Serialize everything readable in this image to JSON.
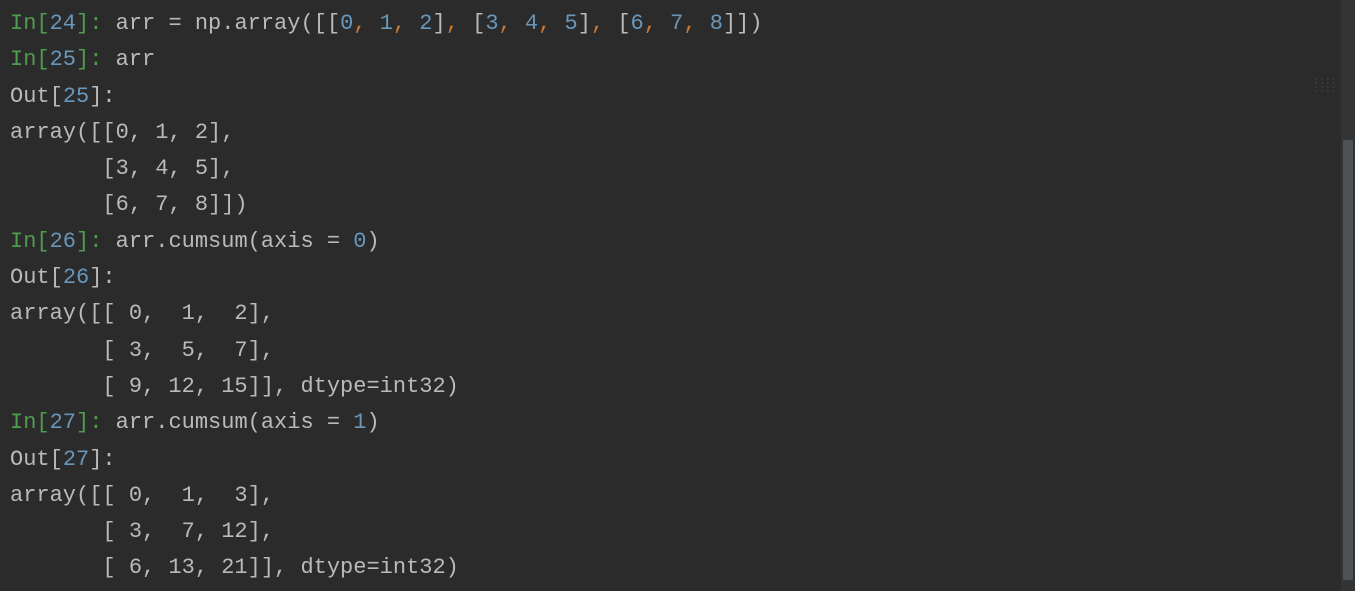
{
  "lines": [
    {
      "type": "in",
      "n": "24",
      "code_tokens": [
        {
          "t": " ",
          "c": "paren"
        },
        {
          "t": "arr ",
          "c": "func-name"
        },
        {
          "t": "=",
          "c": "op"
        },
        {
          "t": " np",
          "c": "func-name"
        },
        {
          "t": ".",
          "c": "dot"
        },
        {
          "t": "array([[",
          "c": "paren"
        },
        {
          "t": "0",
          "c": "number"
        },
        {
          "t": ", ",
          "c": "keyword"
        },
        {
          "t": "1",
          "c": "number"
        },
        {
          "t": ", ",
          "c": "keyword"
        },
        {
          "t": "2",
          "c": "number"
        },
        {
          "t": "]",
          "c": "paren"
        },
        {
          "t": ", ",
          "c": "keyword"
        },
        {
          "t": "[",
          "c": "paren"
        },
        {
          "t": "3",
          "c": "number"
        },
        {
          "t": ", ",
          "c": "keyword"
        },
        {
          "t": "4",
          "c": "number"
        },
        {
          "t": ", ",
          "c": "keyword"
        },
        {
          "t": "5",
          "c": "number"
        },
        {
          "t": "]",
          "c": "paren"
        },
        {
          "t": ", ",
          "c": "keyword"
        },
        {
          "t": "[",
          "c": "paren"
        },
        {
          "t": "6",
          "c": "number"
        },
        {
          "t": ", ",
          "c": "keyword"
        },
        {
          "t": "7",
          "c": "number"
        },
        {
          "t": ", ",
          "c": "keyword"
        },
        {
          "t": "8",
          "c": "number"
        },
        {
          "t": "]])",
          "c": "paren"
        }
      ]
    },
    {
      "type": "in",
      "n": "25",
      "code_tokens": [
        {
          "t": " arr",
          "c": "func-name"
        }
      ]
    },
    {
      "type": "out",
      "n": "25",
      "text": ""
    },
    {
      "type": "plain",
      "text": "array([[0, 1, 2],"
    },
    {
      "type": "plain",
      "text": "       [3, 4, 5],"
    },
    {
      "type": "plain",
      "text": "       [6, 7, 8]])"
    },
    {
      "type": "in",
      "n": "26",
      "code_tokens": [
        {
          "t": " arr",
          "c": "func-name"
        },
        {
          "t": ".",
          "c": "dot"
        },
        {
          "t": "cumsum(axis ",
          "c": "paren"
        },
        {
          "t": "=",
          "c": "op"
        },
        {
          "t": " ",
          "c": "paren"
        },
        {
          "t": "0",
          "c": "number"
        },
        {
          "t": ")",
          "c": "paren"
        }
      ]
    },
    {
      "type": "out",
      "n": "26",
      "text": ""
    },
    {
      "type": "plain",
      "text": "array([[ 0,  1,  2],"
    },
    {
      "type": "plain",
      "text": "       [ 3,  5,  7],"
    },
    {
      "type": "plain",
      "text": "       [ 9, 12, 15]], dtype=int32)"
    },
    {
      "type": "in",
      "n": "27",
      "code_tokens": [
        {
          "t": " arr",
          "c": "func-name"
        },
        {
          "t": ".",
          "c": "dot"
        },
        {
          "t": "cumsum(axis ",
          "c": "paren"
        },
        {
          "t": "=",
          "c": "op"
        },
        {
          "t": " ",
          "c": "paren"
        },
        {
          "t": "1",
          "c": "number"
        },
        {
          "t": ")",
          "c": "paren"
        }
      ]
    },
    {
      "type": "out",
      "n": "27",
      "text": ""
    },
    {
      "type": "plain",
      "text": "array([[ 0,  1,  3],"
    },
    {
      "type": "plain",
      "text": "       [ 3,  7, 12],"
    },
    {
      "type": "plain",
      "text": "       [ 6, 13, 21]], dtype=int32)"
    }
  ],
  "labels": {
    "in_prefix": "In[",
    "out_prefix": "Out[",
    "suffix": "]:"
  }
}
